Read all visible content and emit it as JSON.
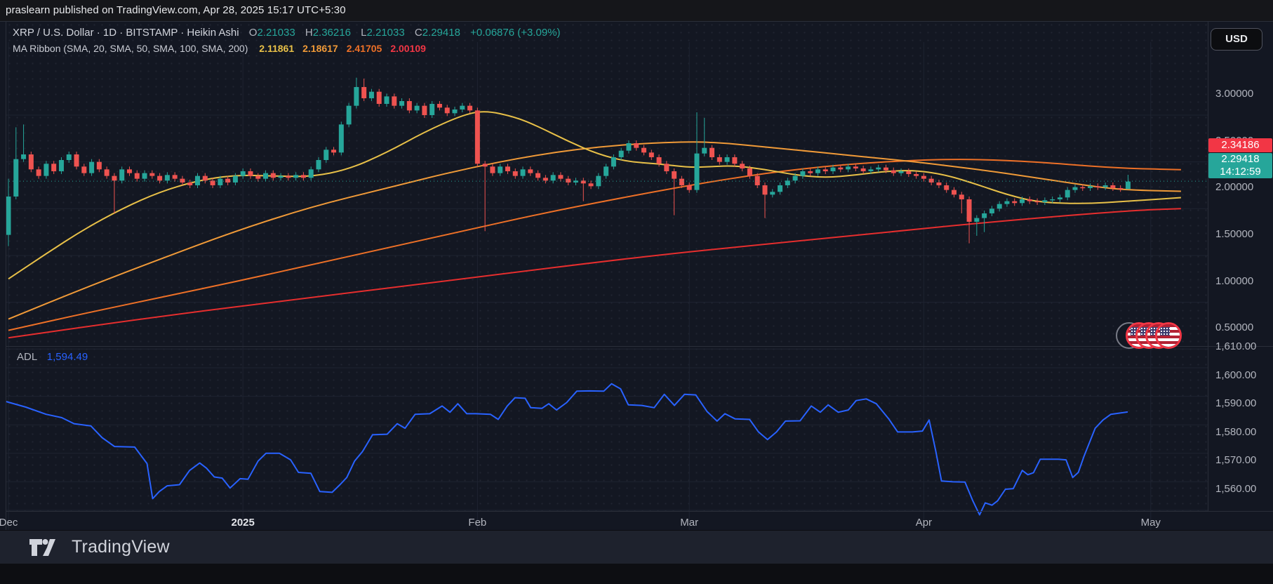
{
  "topbar": {
    "attribution": "praslearn published on TradingView.com, Apr 28, 2025 15:17 UTC+5:30"
  },
  "toolbar": {
    "currency_label": "USD"
  },
  "legend": {
    "title": "XRP / U.S. Dollar · 1D · BITSTAMP · Heikin Ashi",
    "ohlc": {
      "o_label": "O",
      "o": "2.21033",
      "h_label": "H",
      "h": "2.36216",
      "l_label": "L",
      "l": "2.21033",
      "c_label": "C",
      "c": "2.29418",
      "change": "+0.06876 (+3.09%)"
    },
    "indicator": {
      "name": "MA Ribbon (SMA, 20, SMA, 50, SMA, 100, SMA, 200)",
      "values": [
        {
          "text": "2.11861",
          "color": "#e8c048"
        },
        {
          "text": "2.18617",
          "color": "#f09a38"
        },
        {
          "text": "2.41705",
          "color": "#ed7027"
        },
        {
          "text": "2.00109",
          "color": "#f23645"
        }
      ]
    }
  },
  "price_axis": {
    "labels": [
      {
        "text": "3.00000",
        "price": 3.0
      },
      {
        "text": "2.50000",
        "price": 2.5
      },
      {
        "text": "2.00000",
        "price": 2.0
      },
      {
        "text": "1.50000",
        "price": 1.5
      },
      {
        "text": "1.00000",
        "price": 1.0
      },
      {
        "text": "0.50000",
        "price": 0.5
      }
    ],
    "red_badge": {
      "text": "2.34186",
      "color": "#f23645"
    },
    "last_badge": {
      "price": "2.29418",
      "countdown": "14:12:59",
      "color": "#26a69a"
    }
  },
  "adl": {
    "label": "ADL",
    "value": "1,594.49",
    "value_color": "#2962ff",
    "axis_labels": [
      {
        "text": "1,610.00",
        "value": 1610
      },
      {
        "text": "1,600.00",
        "value": 1600
      },
      {
        "text": "1,590.00",
        "value": 1590
      },
      {
        "text": "1,580.00",
        "value": 1580
      },
      {
        "text": "1,570.00",
        "value": 1570
      },
      {
        "text": "1,560.00",
        "value": 1560
      }
    ]
  },
  "time_axis": {
    "ticks": [
      {
        "label": "Dec",
        "day": 0,
        "emph": false
      },
      {
        "label": "2025",
        "day": 31,
        "emph": true
      },
      {
        "label": "Feb",
        "day": 62,
        "emph": false
      },
      {
        "label": "Mar",
        "day": 90,
        "emph": false
      },
      {
        "label": "Apr",
        "day": 121,
        "emph": false
      },
      {
        "label": "May",
        "day": 151,
        "emph": false
      }
    ]
  },
  "markers": {
    "gray_chip": 1,
    "us_flag_chips": 4
  },
  "footer": {
    "brand": "TradingView"
  },
  "colors": {
    "background": "#131722",
    "grid": "#1e2330",
    "up": "#26a69a",
    "down": "#ef5350",
    "sma20": "#e8c048",
    "sma50": "#f09a38",
    "sma100": "#ed7027",
    "sma200": "#e62e2e",
    "adl_line": "#2962ff",
    "last_price_dotted": "#26a69a"
  },
  "chart_data": [
    {
      "type": "candlestick",
      "pane": "price",
      "title": "XRP / U.S. Dollar, 1D Heikin Ashi",
      "x_unit": "days since Dec 1 2024",
      "ylim": [
        0.35,
        3.45
      ],
      "month_tick_days": [
        0,
        31,
        62,
        90,
        121,
        151
      ],
      "grid_prices": [
        3.0,
        2.5,
        2.0,
        1.5,
        1.0,
        0.5
      ],
      "last_price": 2.29418,
      "first_open": 1.72,
      "default_wick": 0.03,
      "closes": [
        2.13,
        2.53,
        2.58,
        2.42,
        2.35,
        2.48,
        2.4,
        2.52,
        2.58,
        2.45,
        2.38,
        2.5,
        2.42,
        2.35,
        2.3,
        2.42,
        2.38,
        2.32,
        2.38,
        2.35,
        2.3,
        2.36,
        2.32,
        2.28,
        2.25,
        2.35,
        2.3,
        2.25,
        2.32,
        2.28,
        2.35,
        2.4,
        2.35,
        2.32,
        2.38,
        2.33,
        2.35,
        2.33,
        2.36,
        2.33,
        2.42,
        2.52,
        2.63,
        2.6,
        2.9,
        3.1,
        3.3,
        3.18,
        3.25,
        3.12,
        3.2,
        3.1,
        3.15,
        3.05,
        3.1,
        3.0,
        3.12,
        3.08,
        3.02,
        3.06,
        3.1,
        3.05,
        2.48,
        2.45,
        2.38,
        2.45,
        2.4,
        2.35,
        2.42,
        2.38,
        2.33,
        2.3,
        2.36,
        2.32,
        2.28,
        2.3,
        2.27,
        2.24,
        2.35,
        2.45,
        2.55,
        2.62,
        2.7,
        2.65,
        2.6,
        2.55,
        2.48,
        2.4,
        2.32,
        2.25,
        2.2,
        2.59,
        2.65,
        2.55,
        2.5,
        2.55,
        2.48,
        2.43,
        2.35,
        2.25,
        2.15,
        2.18,
        2.25,
        2.3,
        2.35,
        2.4,
        2.38,
        2.42,
        2.4,
        2.44,
        2.42,
        2.45,
        2.43,
        2.4,
        2.42,
        2.44,
        2.41,
        2.38,
        2.4,
        2.37,
        2.35,
        2.32,
        2.28,
        2.25,
        2.2,
        2.15,
        2.1,
        1.86,
        1.9,
        1.95,
        2.0,
        2.05,
        2.08,
        2.06,
        2.1,
        2.08,
        2.07,
        2.09,
        2.1,
        2.12,
        2.2,
        2.23,
        2.22,
        2.24,
        2.23,
        2.25,
        2.22,
        2.21,
        2.29
      ],
      "wick_overrides": {
        "0": [
          2.32,
          1.6
        ],
        "1": [
          2.87,
          null
        ],
        "2": [
          2.9,
          null
        ],
        "14": [
          null,
          1.95
        ],
        "46": [
          3.4,
          null
        ],
        "47": [
          3.39,
          null
        ],
        "63": [
          null,
          1.76
        ],
        "76": [
          null,
          2.08
        ],
        "88": [
          null,
          1.93
        ],
        "91": [
          3.03,
          null
        ],
        "92": [
          2.97,
          null
        ],
        "100": [
          null,
          1.9
        ],
        "126": [
          null,
          1.95
        ],
        "127": [
          null,
          1.63
        ],
        "128": [
          null,
          1.71
        ],
        "129": [
          null,
          1.75
        ],
        "148": [
          2.36216,
          2.21033
        ]
      },
      "ma_ribbon": {
        "sma20": [
          [
            0,
            1.25
          ],
          [
            5,
            1.52
          ],
          [
            10,
            1.78
          ],
          [
            15,
            2.0
          ],
          [
            20,
            2.18
          ],
          [
            25,
            2.3
          ],
          [
            30,
            2.36
          ],
          [
            35,
            2.35
          ],
          [
            40,
            2.34
          ],
          [
            45,
            2.42
          ],
          [
            50,
            2.6
          ],
          [
            55,
            2.82
          ],
          [
            60,
            3.0
          ],
          [
            63,
            3.05
          ],
          [
            67,
            2.98
          ],
          [
            70,
            2.88
          ],
          [
            74,
            2.72
          ],
          [
            78,
            2.58
          ],
          [
            82,
            2.5
          ],
          [
            86,
            2.48
          ],
          [
            90,
            2.44
          ],
          [
            93,
            2.45
          ],
          [
            96,
            2.46
          ],
          [
            100,
            2.42
          ],
          [
            104,
            2.36
          ],
          [
            108,
            2.33
          ],
          [
            112,
            2.36
          ],
          [
            116,
            2.4
          ],
          [
            120,
            2.41
          ],
          [
            124,
            2.36
          ],
          [
            128,
            2.26
          ],
          [
            132,
            2.15
          ],
          [
            136,
            2.07
          ],
          [
            142,
            2.05
          ],
          [
            148,
            2.08
          ],
          [
            155,
            2.11861
          ]
        ],
        "sma50": [
          [
            0,
            0.82
          ],
          [
            10,
            1.15
          ],
          [
            20,
            1.46
          ],
          [
            30,
            1.76
          ],
          [
            40,
            2.02
          ],
          [
            50,
            2.22
          ],
          [
            60,
            2.42
          ],
          [
            70,
            2.58
          ],
          [
            80,
            2.68
          ],
          [
            90,
            2.72
          ],
          [
            95,
            2.7
          ],
          [
            100,
            2.66
          ],
          [
            105,
            2.62
          ],
          [
            110,
            2.58
          ],
          [
            115,
            2.54
          ],
          [
            120,
            2.5
          ],
          [
            125,
            2.45
          ],
          [
            130,
            2.4
          ],
          [
            135,
            2.34
          ],
          [
            140,
            2.28
          ],
          [
            144,
            2.23
          ],
          [
            148,
            2.2
          ],
          [
            155,
            2.18617
          ]
        ],
        "sma100": [
          [
            0,
            0.7
          ],
          [
            10,
            0.88
          ],
          [
            20,
            1.05
          ],
          [
            30,
            1.22
          ],
          [
            40,
            1.4
          ],
          [
            50,
            1.58
          ],
          [
            60,
            1.76
          ],
          [
            70,
            1.94
          ],
          [
            80,
            2.1
          ],
          [
            90,
            2.25
          ],
          [
            100,
            2.38
          ],
          [
            110,
            2.47
          ],
          [
            120,
            2.52
          ],
          [
            128,
            2.53
          ],
          [
            136,
            2.5
          ],
          [
            142,
            2.46
          ],
          [
            148,
            2.43
          ],
          [
            155,
            2.41705
          ]
        ],
        "sma200": [
          [
            0,
            0.62
          ],
          [
            20,
            0.85
          ],
          [
            40,
            1.05
          ],
          [
            60,
            1.25
          ],
          [
            84,
            1.49
          ],
          [
            100,
            1.62
          ],
          [
            115,
            1.74
          ],
          [
            130,
            1.86
          ],
          [
            148,
            1.98
          ],
          [
            155,
            2.00109
          ]
        ]
      }
    },
    {
      "type": "line",
      "pane": "indicator",
      "title": "ADL",
      "last_value": 1594.49,
      "ylim": [
        1552,
        1612
      ],
      "grid_values": [
        1610,
        1600,
        1590,
        1580,
        1570,
        1560
      ],
      "points": [
        [
          0.0,
          1598.2
        ],
        [
          0.018,
          1596.2
        ],
        [
          0.036,
          1593.7
        ],
        [
          0.05,
          1592.5
        ],
        [
          0.061,
          1590.4
        ],
        [
          0.076,
          1589.6
        ],
        [
          0.086,
          1585.5
        ],
        [
          0.097,
          1582.4
        ],
        [
          0.115,
          1582.2
        ],
        [
          0.126,
          1576.4
        ],
        [
          0.131,
          1564.1
        ],
        [
          0.137,
          1566.6
        ],
        [
          0.144,
          1568.6
        ],
        [
          0.155,
          1569.0
        ],
        [
          0.164,
          1574.0
        ],
        [
          0.173,
          1576.6
        ],
        [
          0.179,
          1574.8
        ],
        [
          0.186,
          1571.7
        ],
        [
          0.193,
          1571.3
        ],
        [
          0.2,
          1567.8
        ],
        [
          0.209,
          1571.1
        ],
        [
          0.216,
          1570.9
        ],
        [
          0.225,
          1577.3
        ],
        [
          0.232,
          1580.0
        ],
        [
          0.244,
          1580.0
        ],
        [
          0.254,
          1577.7
        ],
        [
          0.261,
          1573.3
        ],
        [
          0.272,
          1573.0
        ],
        [
          0.28,
          1566.6
        ],
        [
          0.291,
          1566.3
        ],
        [
          0.298,
          1569.0
        ],
        [
          0.304,
          1571.5
        ],
        [
          0.311,
          1577.3
        ],
        [
          0.318,
          1580.6
        ],
        [
          0.327,
          1586.5
        ],
        [
          0.34,
          1586.7
        ],
        [
          0.349,
          1590.4
        ],
        [
          0.356,
          1588.8
        ],
        [
          0.365,
          1593.7
        ],
        [
          0.378,
          1593.9
        ],
        [
          0.389,
          1596.6
        ],
        [
          0.396,
          1594.4
        ],
        [
          0.403,
          1597.4
        ],
        [
          0.411,
          1593.9
        ],
        [
          0.419,
          1593.9
        ],
        [
          0.432,
          1593.7
        ],
        [
          0.439,
          1591.9
        ],
        [
          0.447,
          1596.6
        ],
        [
          0.454,
          1599.5
        ],
        [
          0.463,
          1599.3
        ],
        [
          0.468,
          1596.0
        ],
        [
          0.478,
          1595.8
        ],
        [
          0.484,
          1597.4
        ],
        [
          0.491,
          1595.2
        ],
        [
          0.5,
          1597.8
        ],
        [
          0.509,
          1601.8
        ],
        [
          0.52,
          1601.9
        ],
        [
          0.533,
          1601.8
        ],
        [
          0.54,
          1604.4
        ],
        [
          0.548,
          1602.6
        ],
        [
          0.555,
          1597.0
        ],
        [
          0.567,
          1596.8
        ],
        [
          0.578,
          1596.0
        ],
        [
          0.587,
          1600.7
        ],
        [
          0.596,
          1596.8
        ],
        [
          0.605,
          1600.7
        ],
        [
          0.615,
          1600.5
        ],
        [
          0.625,
          1594.7
        ],
        [
          0.634,
          1591.3
        ],
        [
          0.641,
          1593.9
        ],
        [
          0.65,
          1592.1
        ],
        [
          0.663,
          1591.9
        ],
        [
          0.671,
          1587.5
        ],
        [
          0.679,
          1584.8
        ],
        [
          0.687,
          1587.5
        ],
        [
          0.695,
          1591.3
        ],
        [
          0.708,
          1591.4
        ],
        [
          0.718,
          1596.6
        ],
        [
          0.726,
          1594.4
        ],
        [
          0.733,
          1597.0
        ],
        [
          0.742,
          1594.4
        ],
        [
          0.751,
          1595.2
        ],
        [
          0.758,
          1598.5
        ],
        [
          0.767,
          1599.1
        ],
        [
          0.776,
          1597.4
        ],
        [
          0.787,
          1592.1
        ],
        [
          0.795,
          1587.5
        ],
        [
          0.808,
          1587.5
        ],
        [
          0.817,
          1587.8
        ],
        [
          0.823,
          1591.7
        ],
        [
          0.829,
          1580.6
        ],
        [
          0.834,
          1570.3
        ],
        [
          0.844,
          1570.0
        ],
        [
          0.855,
          1569.9
        ],
        [
          0.862,
          1563.3
        ],
        [
          0.868,
          1558.4
        ],
        [
          0.873,
          1562.6
        ],
        [
          0.879,
          1561.8
        ],
        [
          0.884,
          1563.3
        ],
        [
          0.891,
          1567.4
        ],
        [
          0.898,
          1567.6
        ],
        [
          0.906,
          1574.0
        ],
        [
          0.911,
          1572.5
        ],
        [
          0.916,
          1573.2
        ],
        [
          0.922,
          1577.9
        ],
        [
          0.938,
          1577.9
        ],
        [
          0.945,
          1577.7
        ],
        [
          0.951,
          1571.5
        ],
        [
          0.956,
          1573.3
        ],
        [
          0.961,
          1578.9
        ],
        [
          0.971,
          1588.8
        ],
        [
          0.978,
          1591.7
        ],
        [
          0.985,
          1593.7
        ],
        [
          1.0,
          1594.5
        ]
      ]
    }
  ]
}
